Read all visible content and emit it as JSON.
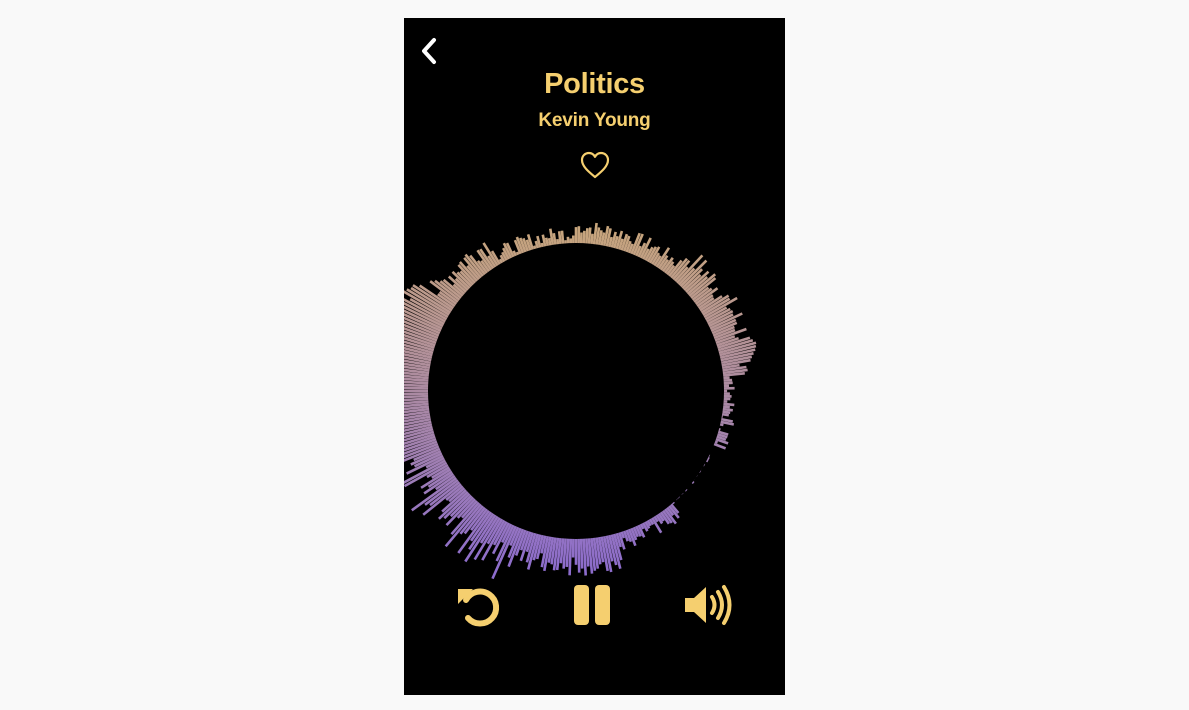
{
  "player": {
    "title": "Politics",
    "artist": "Kevin Young",
    "liked": false
  },
  "icons": {
    "back": "chevron-left-icon",
    "like": "heart-outline-icon",
    "replay": "replay-icon",
    "pause": "pause-icon",
    "volume": "volume-high-icon"
  },
  "colors": {
    "accent": "#f5cf6f",
    "back_icon": "#ffffff",
    "background": "#000000",
    "page_background": "#f9f9f9",
    "visualizer_top": "#c9a77a",
    "visualizer_bottom": "#8a6ad0"
  }
}
